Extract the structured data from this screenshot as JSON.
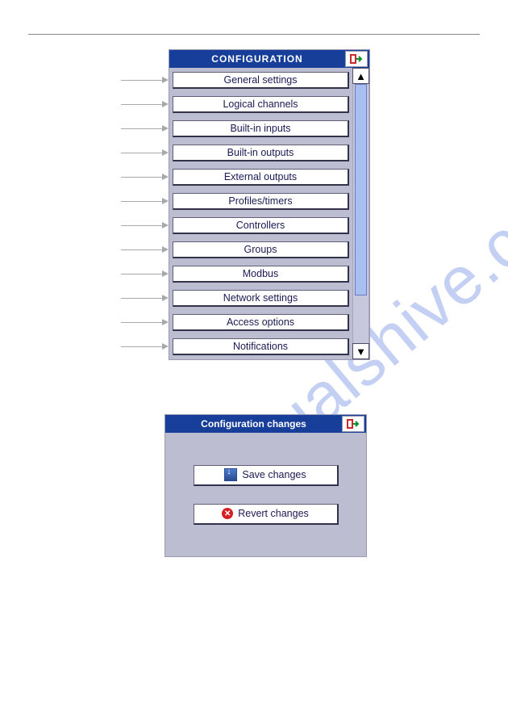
{
  "watermark": "manualshive.com",
  "config_panel": {
    "title": "CONFIGURATION",
    "items": [
      "General settings",
      "Logical channels",
      "Built-in inputs",
      "Built-in outputs",
      "External outputs",
      "Profiles/timers",
      "Controllers",
      "Groups",
      "Modbus",
      "Network settings",
      "Access options",
      "Notifications"
    ],
    "scroll_up": "▲",
    "scroll_down": "▼"
  },
  "changes_panel": {
    "title": "Configuration changes",
    "save_label": "Save changes",
    "revert_label": "Revert changes",
    "cancel_glyph": "✕"
  }
}
